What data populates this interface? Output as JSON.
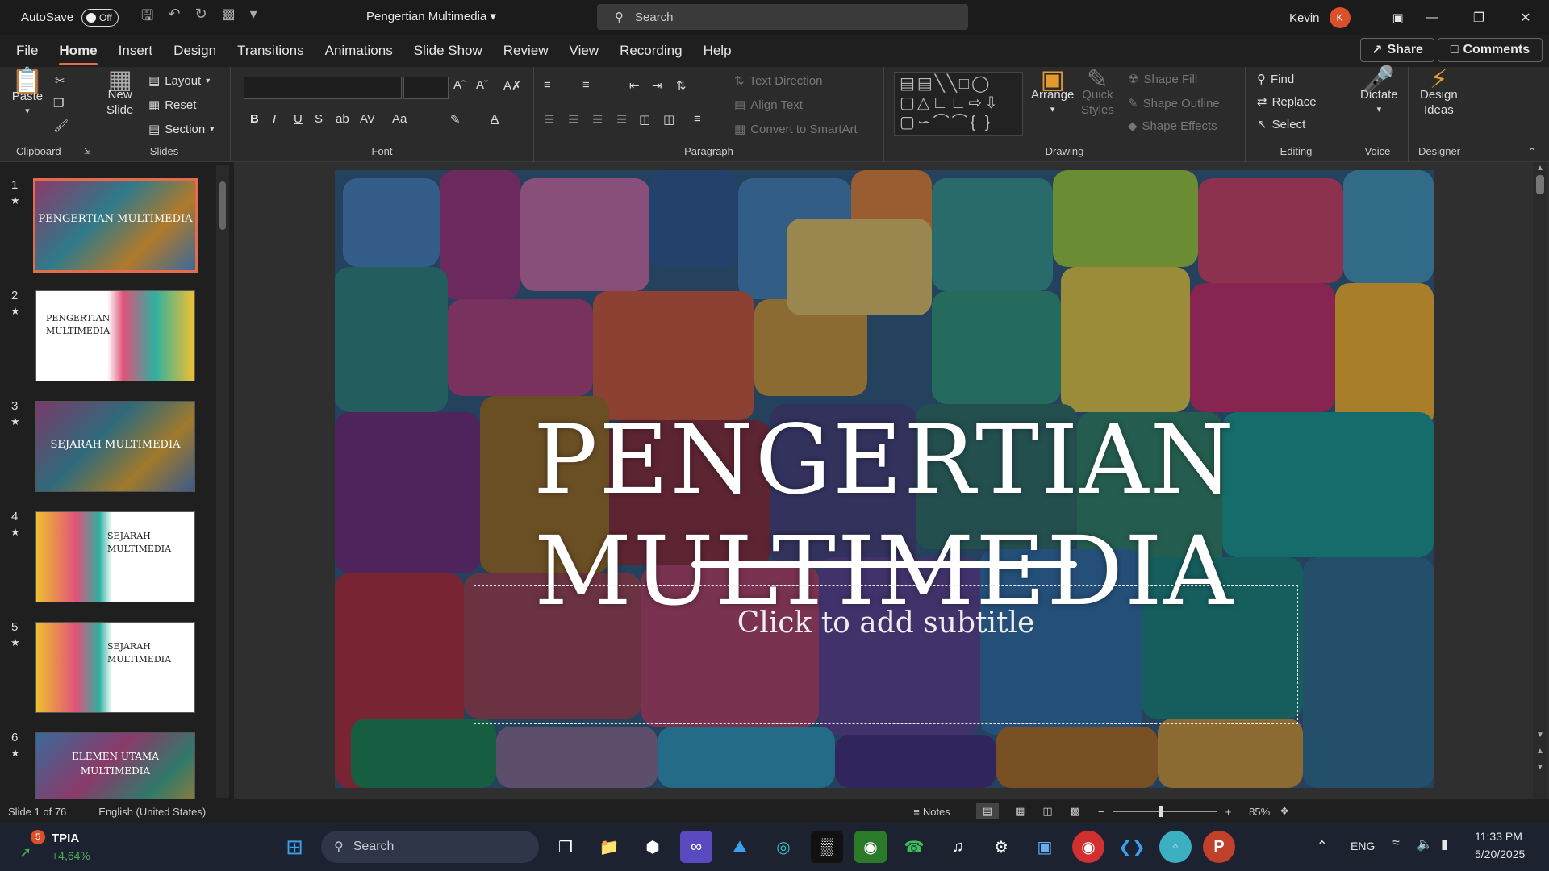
{
  "titlebar": {
    "autosave_label": "AutoSave",
    "autosave_state": "Off",
    "doc_title": "Pengertian Multimedia",
    "search_placeholder": "Search",
    "user_name": "Kevin",
    "user_initial": "K"
  },
  "menu": {
    "tabs": [
      "File",
      "Home",
      "Insert",
      "Design",
      "Transitions",
      "Animations",
      "Slide Show",
      "Review",
      "View",
      "Recording",
      "Help"
    ],
    "active": "Home",
    "share": "Share",
    "comments": "Comments"
  },
  "ribbon": {
    "clipboard": {
      "label": "Clipboard",
      "paste": "Paste"
    },
    "slides": {
      "label": "Slides",
      "new_slide_1": "New",
      "new_slide_2": "Slide",
      "layout": "Layout",
      "reset": "Reset",
      "section": "Section"
    },
    "font": {
      "label": "Font"
    },
    "paragraph": {
      "label": "Paragraph",
      "text_direction": "Text Direction",
      "align_text": "Align Text",
      "convert_smartart": "Convert to SmartArt"
    },
    "drawing": {
      "label": "Drawing",
      "arrange": "Arrange",
      "quick_styles_1": "Quick",
      "quick_styles_2": "Styles",
      "shape_fill": "Shape Fill",
      "shape_outline": "Shape Outline",
      "shape_effects": "Shape Effects"
    },
    "editing": {
      "label": "Editing",
      "find": "Find",
      "replace": "Replace",
      "select": "Select"
    },
    "voice": {
      "label": "Voice",
      "dictate": "Dictate"
    },
    "designer": {
      "label": "Designer",
      "design_ideas_1": "Design",
      "design_ideas_2": "Ideas"
    }
  },
  "thumbnails": [
    {
      "num": "1",
      "lines": [
        "PENGERTIAN MULTIMEDIA"
      ],
      "style": "full"
    },
    {
      "num": "2",
      "lines": [
        "PENGERTIAN",
        "MULTIMEDIA"
      ],
      "style": "white-right"
    },
    {
      "num": "3",
      "lines": [
        "SEJARAH MULTIMEDIA"
      ],
      "style": "full"
    },
    {
      "num": "4",
      "lines": [
        "SEJARAH",
        "MULTIMEDIA"
      ],
      "style": "white-left"
    },
    {
      "num": "5",
      "lines": [
        "SEJARAH",
        "MULTIMEDIA"
      ],
      "style": "white-left"
    },
    {
      "num": "6",
      "lines": [
        "ELEMEN UTAMA",
        "MULTIMEDIA"
      ],
      "style": "full"
    }
  ],
  "slide": {
    "title": "PENGERTIAN MULTIMEDIA",
    "subtitle_placeholder": "Click to add subtitle"
  },
  "status": {
    "slide_count": "Slide 1 of 76",
    "language": "English (United States)",
    "notes": "Notes",
    "zoom": "85%"
  },
  "taskbar": {
    "stock_badge": "5",
    "stock_name": "TPIA",
    "stock_change": "+4,64%",
    "search": "Search",
    "lang": "ENG",
    "time": "11:33 PM",
    "date": "5/20/2025"
  },
  "colors": {
    "accent": "#e46c4a",
    "stock_green": "#4caf50"
  }
}
